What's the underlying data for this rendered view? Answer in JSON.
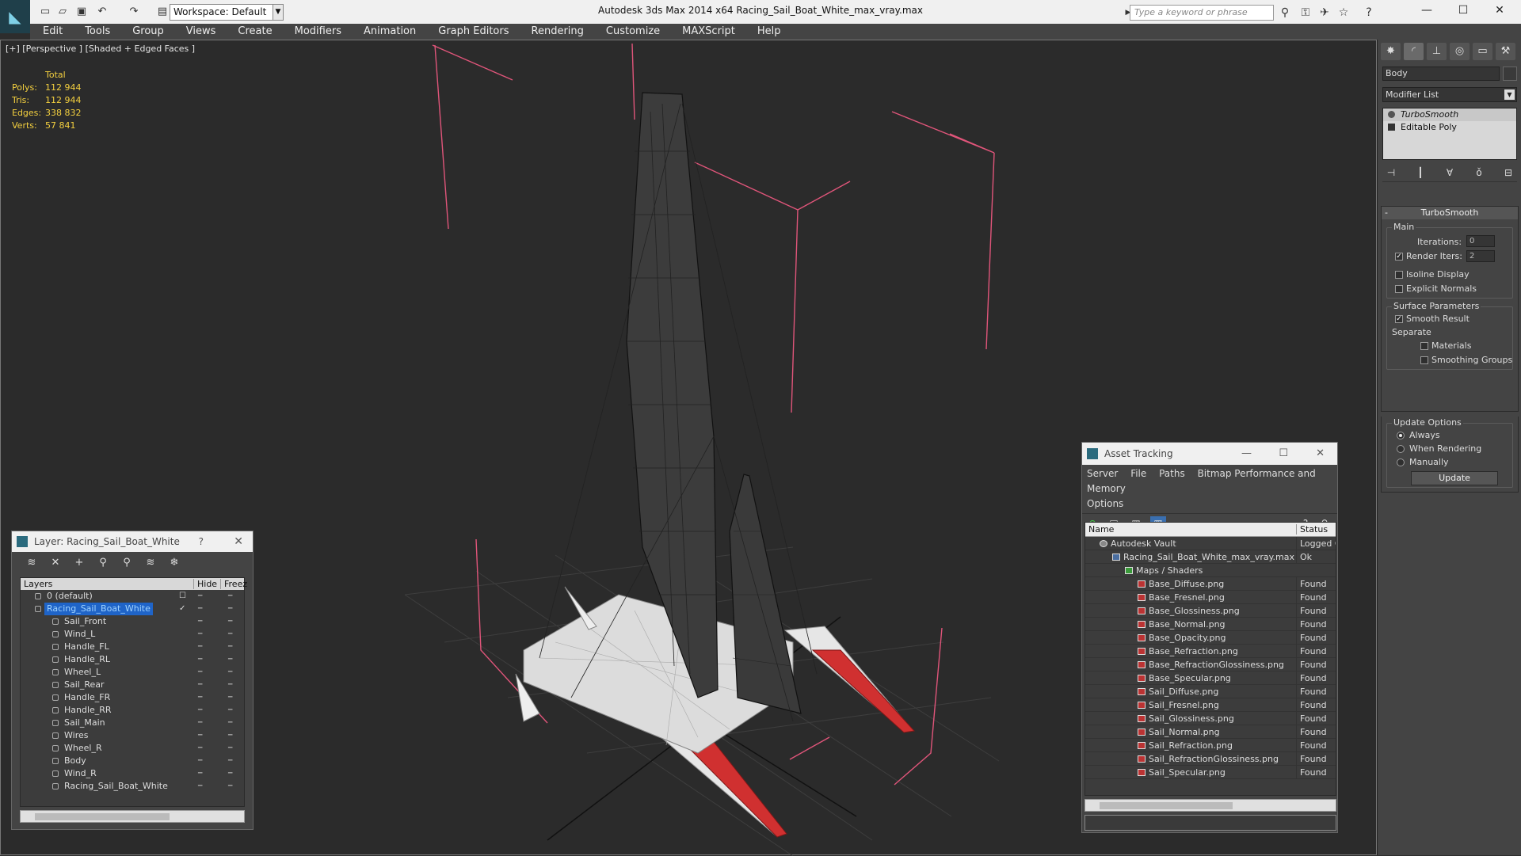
{
  "titlebar": {
    "workspace": "Workspace: Default",
    "window_title": "Autodesk 3ds Max  2014 x64     Racing_Sail_Boat_White_max_vray.max",
    "search_placeholder": "Type a keyword or phrase"
  },
  "menu": [
    "Edit",
    "Tools",
    "Group",
    "Views",
    "Create",
    "Modifiers",
    "Animation",
    "Graph Editors",
    "Rendering",
    "Customize",
    "MAXScript",
    "Help"
  ],
  "viewport": {
    "label": "[+] [Perspective ] [Shaded + Edged Faces ]",
    "stats": {
      "header": "Total",
      "polys_label": "Polys:",
      "polys": "112 944",
      "tris_label": "Tris:",
      "tris": "112 944",
      "edges_label": "Edges:",
      "edges": "338 832",
      "verts_label": "Verts:",
      "verts": "57 841"
    }
  },
  "command_panel": {
    "object_name": "Body",
    "modifier_list": "Modifier List",
    "stack": [
      "TurboSmooth",
      "Editable Poly"
    ],
    "turbosmooth": {
      "title": "TurboSmooth",
      "main": "Main",
      "iterations_label": "Iterations:",
      "iterations": "0",
      "render_iters_label": "Render Iters:",
      "render_iters": "2",
      "isoline": "Isoline Display",
      "explicit_normals": "Explicit Normals",
      "surface_params": "Surface Parameters",
      "smooth_result": "Smooth Result",
      "separate": "Separate",
      "materials": "Materials",
      "smoothing_groups": "Smoothing Groups",
      "update_options": "Update Options",
      "always": "Always",
      "when_rendering": "When Rendering",
      "manually": "Manually",
      "update": "Update"
    }
  },
  "layer_panel": {
    "title": "Layer: Racing_Sail_Boat_White",
    "help": "?",
    "col_layers": "Layers",
    "col_hide": "Hide",
    "col_freeze": "Freez",
    "rows": [
      {
        "name": "0 (default)",
        "level": 0
      },
      {
        "name": "Racing_Sail_Boat_White",
        "level": 0,
        "selected": true
      },
      {
        "name": "Sail_Front",
        "level": 1
      },
      {
        "name": "Wind_L",
        "level": 1
      },
      {
        "name": "Handle_FL",
        "level": 1
      },
      {
        "name": "Handle_RL",
        "level": 1
      },
      {
        "name": "Wheel_L",
        "level": 1
      },
      {
        "name": "Sail_Rear",
        "level": 1
      },
      {
        "name": "Handle_FR",
        "level": 1
      },
      {
        "name": "Handle_RR",
        "level": 1
      },
      {
        "name": "Sail_Main",
        "level": 1
      },
      {
        "name": "Wires",
        "level": 1
      },
      {
        "name": "Wheel_R",
        "level": 1
      },
      {
        "name": "Body",
        "level": 1
      },
      {
        "name": "Wind_R",
        "level": 1
      },
      {
        "name": "Racing_Sail_Boat_White",
        "level": 1
      }
    ]
  },
  "asset_panel": {
    "title": "Asset Tracking",
    "menu": [
      "Server",
      "File",
      "Paths",
      "Bitmap Performance and Memory",
      "Options"
    ],
    "col_name": "Name",
    "col_status": "Status",
    "rows": [
      {
        "name": "Autodesk Vault",
        "status": "Logged O",
        "level": 0
      },
      {
        "name": "Racing_Sail_Boat_White_max_vray.max",
        "status": "Ok",
        "level": 1
      },
      {
        "name": "Maps / Shaders",
        "status": "",
        "level": 2
      },
      {
        "name": "Base_Diffuse.png",
        "status": "Found",
        "level": 3
      },
      {
        "name": "Base_Fresnel.png",
        "status": "Found",
        "level": 3
      },
      {
        "name": "Base_Glossiness.png",
        "status": "Found",
        "level": 3
      },
      {
        "name": "Base_Normal.png",
        "status": "Found",
        "level": 3
      },
      {
        "name": "Base_Opacity.png",
        "status": "Found",
        "level": 3
      },
      {
        "name": "Base_Refraction.png",
        "status": "Found",
        "level": 3
      },
      {
        "name": "Base_RefractionGlossiness.png",
        "status": "Found",
        "level": 3
      },
      {
        "name": "Base_Specular.png",
        "status": "Found",
        "level": 3
      },
      {
        "name": "Sail_Diffuse.png",
        "status": "Found",
        "level": 3
      },
      {
        "name": "Sail_Fresnel.png",
        "status": "Found",
        "level": 3
      },
      {
        "name": "Sail_Glossiness.png",
        "status": "Found",
        "level": 3
      },
      {
        "name": "Sail_Normal.png",
        "status": "Found",
        "level": 3
      },
      {
        "name": "Sail_Refraction.png",
        "status": "Found",
        "level": 3
      },
      {
        "name": "Sail_RefractionGlossiness.png",
        "status": "Found",
        "level": 3
      },
      {
        "name": "Sail_Specular.png",
        "status": "Found",
        "level": 3
      }
    ]
  },
  "colors": {
    "stats": "#f4d03f",
    "selection": "#1f64c8",
    "hull_red": "#d03030",
    "gizmo_pink": "#e0557a"
  }
}
